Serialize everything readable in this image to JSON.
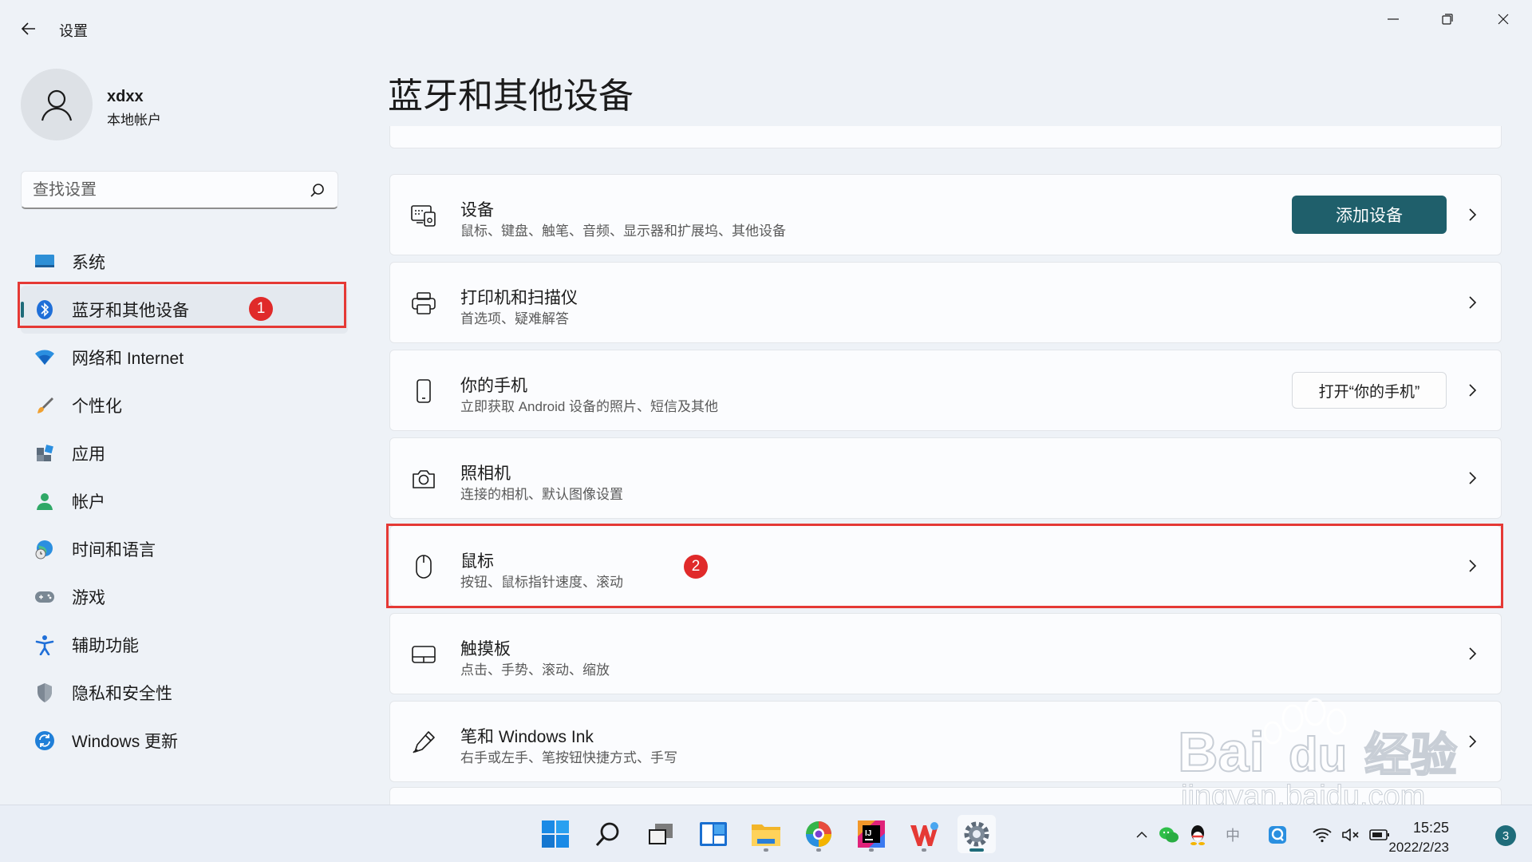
{
  "window": {
    "title": "设置",
    "controls": {
      "minimize": "minimize-icon",
      "restore": "restore-icon",
      "close": "close-icon"
    }
  },
  "profile": {
    "name": "xdxx",
    "account_type": "本地帐户"
  },
  "search": {
    "placeholder": "查找设置",
    "value": ""
  },
  "sidebar": {
    "items": [
      {
        "label": "系统",
        "icon": "system-icon",
        "active": false
      },
      {
        "label": "蓝牙和其他设备",
        "icon": "bluetooth-icon",
        "active": true
      },
      {
        "label": "网络和 Internet",
        "icon": "wifi-icon",
        "active": false
      },
      {
        "label": "个性化",
        "icon": "brush-icon",
        "active": false
      },
      {
        "label": "应用",
        "icon": "apps-icon",
        "active": false
      },
      {
        "label": "帐户",
        "icon": "account-icon",
        "active": false
      },
      {
        "label": "时间和语言",
        "icon": "globe-clock-icon",
        "active": false
      },
      {
        "label": "游戏",
        "icon": "gamepad-icon",
        "active": false
      },
      {
        "label": "辅助功能",
        "icon": "accessibility-icon",
        "active": false
      },
      {
        "label": "隐私和安全性",
        "icon": "shield-icon",
        "active": false
      },
      {
        "label": "Windows 更新",
        "icon": "update-icon",
        "active": false
      }
    ]
  },
  "annotations": {
    "badge1": "1",
    "badge2": "2"
  },
  "main": {
    "title": "蓝牙和其他设备",
    "cards": [
      {
        "title": "设备",
        "subtitle": "鼠标、键盘、触笔、音频、显示器和扩展坞、其他设备",
        "icon": "devices-icon",
        "button": "添加设备"
      },
      {
        "title": "打印机和扫描仪",
        "subtitle": "首选项、疑难解答",
        "icon": "printer-icon"
      },
      {
        "title": "你的手机",
        "subtitle": "立即获取 Android 设备的照片、短信及其他",
        "icon": "phone-icon",
        "button": "打开“你的手机”"
      },
      {
        "title": "照相机",
        "subtitle": "连接的相机、默认图像设置",
        "icon": "camera-icon"
      },
      {
        "title": "鼠标",
        "subtitle": "按钮、鼠标指针速度、滚动",
        "icon": "mouse-icon"
      },
      {
        "title": "触摸板",
        "subtitle": "点击、手势、滚动、缩放",
        "icon": "touchpad-icon"
      },
      {
        "title": "笔和 Windows Ink",
        "subtitle": "右手或左手、笔按钮快捷方式、手写",
        "icon": "pen-icon"
      }
    ]
  },
  "watermark": {
    "brand": "Bai",
    "brand2": "du",
    "brand3": "经验",
    "url": "jingyan.baidu.com"
  },
  "taskbar": {
    "apps": [
      "start-icon",
      "search-icon",
      "task-view-icon",
      "widgets-icon",
      "file-explorer-icon",
      "browser-icon",
      "intellij-icon",
      "wps-icon",
      "settings-icon"
    ],
    "tray": {
      "ime": "中"
    },
    "clock": {
      "time": "15:25",
      "date": "2022/2/23"
    },
    "notifications": "3"
  },
  "colors": {
    "accent": "#1f5f6b",
    "highlight": "#e53935",
    "background": "#eef2f7",
    "card": "#fbfcfe"
  }
}
